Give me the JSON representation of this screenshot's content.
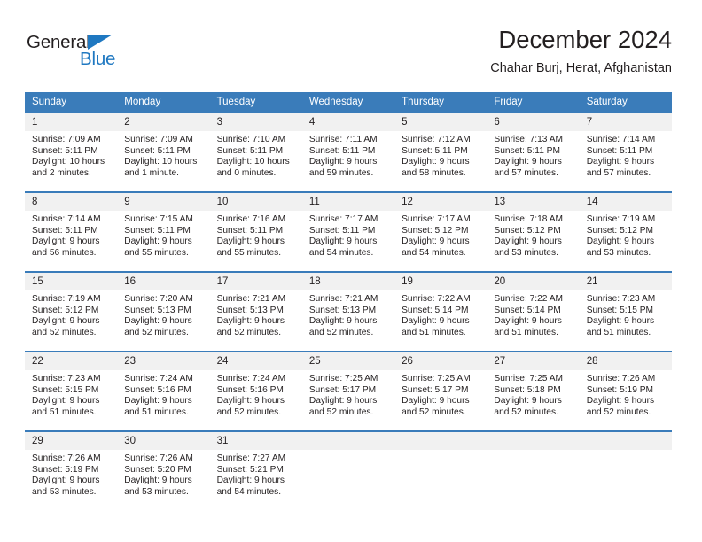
{
  "branding": {
    "logo_text_primary": "General",
    "logo_text_secondary": "Blue",
    "accent_color": "#1f78c1"
  },
  "header": {
    "title": "December 2024",
    "subtitle": "Chahar Burj, Herat, Afghanistan"
  },
  "colors": {
    "header_band": "#3a7cba",
    "daynum_band": "#f1f1f1",
    "text": "#231f20"
  },
  "weekdays": [
    "Sunday",
    "Monday",
    "Tuesday",
    "Wednesday",
    "Thursday",
    "Friday",
    "Saturday"
  ],
  "labels": {
    "sunrise_prefix": "Sunrise:",
    "sunset_prefix": "Sunset:",
    "daylight_prefix": "Daylight:"
  },
  "weeks": [
    [
      {
        "day": "1",
        "sunrise": "Sunrise: 7:09 AM",
        "sunset": "Sunset: 5:11 PM",
        "daylight_line1": "Daylight: 10 hours",
        "daylight_line2": "and 2 minutes."
      },
      {
        "day": "2",
        "sunrise": "Sunrise: 7:09 AM",
        "sunset": "Sunset: 5:11 PM",
        "daylight_line1": "Daylight: 10 hours",
        "daylight_line2": "and 1 minute."
      },
      {
        "day": "3",
        "sunrise": "Sunrise: 7:10 AM",
        "sunset": "Sunset: 5:11 PM",
        "daylight_line1": "Daylight: 10 hours",
        "daylight_line2": "and 0 minutes."
      },
      {
        "day": "4",
        "sunrise": "Sunrise: 7:11 AM",
        "sunset": "Sunset: 5:11 PM",
        "daylight_line1": "Daylight: 9 hours",
        "daylight_line2": "and 59 minutes."
      },
      {
        "day": "5",
        "sunrise": "Sunrise: 7:12 AM",
        "sunset": "Sunset: 5:11 PM",
        "daylight_line1": "Daylight: 9 hours",
        "daylight_line2": "and 58 minutes."
      },
      {
        "day": "6",
        "sunrise": "Sunrise: 7:13 AM",
        "sunset": "Sunset: 5:11 PM",
        "daylight_line1": "Daylight: 9 hours",
        "daylight_line2": "and 57 minutes."
      },
      {
        "day": "7",
        "sunrise": "Sunrise: 7:14 AM",
        "sunset": "Sunset: 5:11 PM",
        "daylight_line1": "Daylight: 9 hours",
        "daylight_line2": "and 57 minutes."
      }
    ],
    [
      {
        "day": "8",
        "sunrise": "Sunrise: 7:14 AM",
        "sunset": "Sunset: 5:11 PM",
        "daylight_line1": "Daylight: 9 hours",
        "daylight_line2": "and 56 minutes."
      },
      {
        "day": "9",
        "sunrise": "Sunrise: 7:15 AM",
        "sunset": "Sunset: 5:11 PM",
        "daylight_line1": "Daylight: 9 hours",
        "daylight_line2": "and 55 minutes."
      },
      {
        "day": "10",
        "sunrise": "Sunrise: 7:16 AM",
        "sunset": "Sunset: 5:11 PM",
        "daylight_line1": "Daylight: 9 hours",
        "daylight_line2": "and 55 minutes."
      },
      {
        "day": "11",
        "sunrise": "Sunrise: 7:17 AM",
        "sunset": "Sunset: 5:11 PM",
        "daylight_line1": "Daylight: 9 hours",
        "daylight_line2": "and 54 minutes."
      },
      {
        "day": "12",
        "sunrise": "Sunrise: 7:17 AM",
        "sunset": "Sunset: 5:12 PM",
        "daylight_line1": "Daylight: 9 hours",
        "daylight_line2": "and 54 minutes."
      },
      {
        "day": "13",
        "sunrise": "Sunrise: 7:18 AM",
        "sunset": "Sunset: 5:12 PM",
        "daylight_line1": "Daylight: 9 hours",
        "daylight_line2": "and 53 minutes."
      },
      {
        "day": "14",
        "sunrise": "Sunrise: 7:19 AM",
        "sunset": "Sunset: 5:12 PM",
        "daylight_line1": "Daylight: 9 hours",
        "daylight_line2": "and 53 minutes."
      }
    ],
    [
      {
        "day": "15",
        "sunrise": "Sunrise: 7:19 AM",
        "sunset": "Sunset: 5:12 PM",
        "daylight_line1": "Daylight: 9 hours",
        "daylight_line2": "and 52 minutes."
      },
      {
        "day": "16",
        "sunrise": "Sunrise: 7:20 AM",
        "sunset": "Sunset: 5:13 PM",
        "daylight_line1": "Daylight: 9 hours",
        "daylight_line2": "and 52 minutes."
      },
      {
        "day": "17",
        "sunrise": "Sunrise: 7:21 AM",
        "sunset": "Sunset: 5:13 PM",
        "daylight_line1": "Daylight: 9 hours",
        "daylight_line2": "and 52 minutes."
      },
      {
        "day": "18",
        "sunrise": "Sunrise: 7:21 AM",
        "sunset": "Sunset: 5:13 PM",
        "daylight_line1": "Daylight: 9 hours",
        "daylight_line2": "and 52 minutes."
      },
      {
        "day": "19",
        "sunrise": "Sunrise: 7:22 AM",
        "sunset": "Sunset: 5:14 PM",
        "daylight_line1": "Daylight: 9 hours",
        "daylight_line2": "and 51 minutes."
      },
      {
        "day": "20",
        "sunrise": "Sunrise: 7:22 AM",
        "sunset": "Sunset: 5:14 PM",
        "daylight_line1": "Daylight: 9 hours",
        "daylight_line2": "and 51 minutes."
      },
      {
        "day": "21",
        "sunrise": "Sunrise: 7:23 AM",
        "sunset": "Sunset: 5:15 PM",
        "daylight_line1": "Daylight: 9 hours",
        "daylight_line2": "and 51 minutes."
      }
    ],
    [
      {
        "day": "22",
        "sunrise": "Sunrise: 7:23 AM",
        "sunset": "Sunset: 5:15 PM",
        "daylight_line1": "Daylight: 9 hours",
        "daylight_line2": "and 51 minutes."
      },
      {
        "day": "23",
        "sunrise": "Sunrise: 7:24 AM",
        "sunset": "Sunset: 5:16 PM",
        "daylight_line1": "Daylight: 9 hours",
        "daylight_line2": "and 51 minutes."
      },
      {
        "day": "24",
        "sunrise": "Sunrise: 7:24 AM",
        "sunset": "Sunset: 5:16 PM",
        "daylight_line1": "Daylight: 9 hours",
        "daylight_line2": "and 52 minutes."
      },
      {
        "day": "25",
        "sunrise": "Sunrise: 7:25 AM",
        "sunset": "Sunset: 5:17 PM",
        "daylight_line1": "Daylight: 9 hours",
        "daylight_line2": "and 52 minutes."
      },
      {
        "day": "26",
        "sunrise": "Sunrise: 7:25 AM",
        "sunset": "Sunset: 5:17 PM",
        "daylight_line1": "Daylight: 9 hours",
        "daylight_line2": "and 52 minutes."
      },
      {
        "day": "27",
        "sunrise": "Sunrise: 7:25 AM",
        "sunset": "Sunset: 5:18 PM",
        "daylight_line1": "Daylight: 9 hours",
        "daylight_line2": "and 52 minutes."
      },
      {
        "day": "28",
        "sunrise": "Sunrise: 7:26 AM",
        "sunset": "Sunset: 5:19 PM",
        "daylight_line1": "Daylight: 9 hours",
        "daylight_line2": "and 52 minutes."
      }
    ],
    [
      {
        "day": "29",
        "sunrise": "Sunrise: 7:26 AM",
        "sunset": "Sunset: 5:19 PM",
        "daylight_line1": "Daylight: 9 hours",
        "daylight_line2": "and 53 minutes."
      },
      {
        "day": "30",
        "sunrise": "Sunrise: 7:26 AM",
        "sunset": "Sunset: 5:20 PM",
        "daylight_line1": "Daylight: 9 hours",
        "daylight_line2": "and 53 minutes."
      },
      {
        "day": "31",
        "sunrise": "Sunrise: 7:27 AM",
        "sunset": "Sunset: 5:21 PM",
        "daylight_line1": "Daylight: 9 hours",
        "daylight_line2": "and 54 minutes."
      },
      {
        "day": "",
        "sunrise": "",
        "sunset": "",
        "daylight_line1": "",
        "daylight_line2": ""
      },
      {
        "day": "",
        "sunrise": "",
        "sunset": "",
        "daylight_line1": "",
        "daylight_line2": ""
      },
      {
        "day": "",
        "sunrise": "",
        "sunset": "",
        "daylight_line1": "",
        "daylight_line2": ""
      },
      {
        "day": "",
        "sunrise": "",
        "sunset": "",
        "daylight_line1": "",
        "daylight_line2": ""
      }
    ]
  ]
}
